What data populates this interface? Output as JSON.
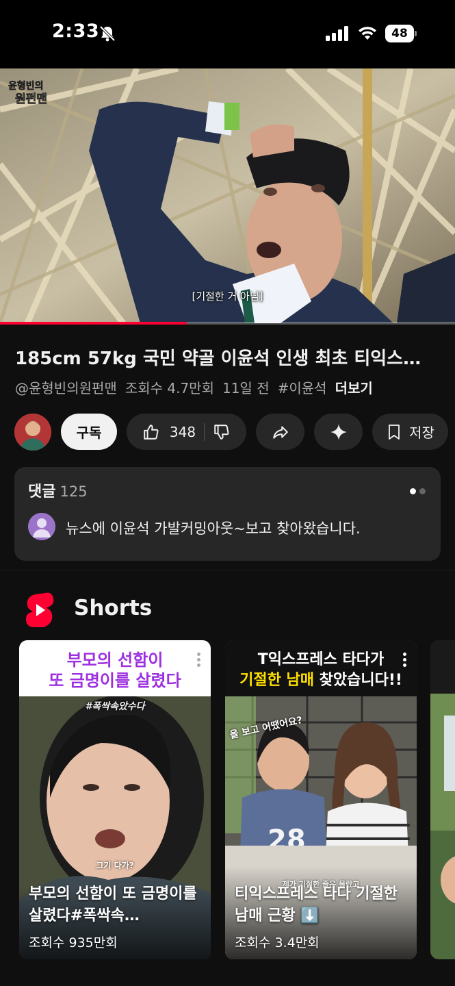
{
  "status_bar": {
    "time": "2:33",
    "battery": "48"
  },
  "video": {
    "subtitle": "[기절한 거 아님]",
    "watermark": "윤형빈의 원펀맨",
    "progress_fraction": 0.41
  },
  "title": "185cm 57kg 국민 약골 이윤석 인생 최초 티익스…",
  "meta": {
    "channel": "@윤형빈의원펀맨",
    "views": "조회수 4.7만회",
    "age": "11일 전",
    "hashtag": "#이윤석",
    "more": "더보기"
  },
  "actions": {
    "subscribe": "구독",
    "likes": "348",
    "save": "저장"
  },
  "comments": {
    "label": "댓글",
    "count": "125",
    "top_comment": "뉴스에 이윤석 가발커밍아웃~보고 찾아왔습니다."
  },
  "shorts": {
    "title": "Shorts",
    "items": [
      {
        "header_line1": "부모의 선함이",
        "header_line2": "또 금명이를 살렸다",
        "overlay_tag": "#폭싹속았수다",
        "overlay_sub": "그기 다가?",
        "caption": "부모의 선함이 또 금명이를 살렸다#폭싹속…",
        "views": "조회수 935만회"
      },
      {
        "header_line1": "T익스프레스 타다가",
        "header_line2_yellow": "기절한 남매",
        "header_line2_rest": " 찾았습니다!!",
        "overlay_tag": "을 보고 어땠어요?",
        "overlay_sub": "제가 기절한 줄은 몰랐고",
        "caption": "티익스프레스 타다 기절한 남매 근황 ⬇️",
        "views": "조회수 3.4만회"
      }
    ]
  },
  "colors": {
    "background": "#0f0f0f",
    "progress": "#ff0033",
    "surface": "#272727",
    "shorts_header_purple": "#9d2fe0",
    "shorts_header_yellow": "#ffe000"
  },
  "icons": [
    "bell-off-icon",
    "signal-icon",
    "wifi-icon",
    "battery-icon",
    "like-icon",
    "dislike-icon",
    "share-icon",
    "sparkle-icon",
    "save-icon",
    "shorts-logo-icon",
    "kebab-icon"
  ]
}
